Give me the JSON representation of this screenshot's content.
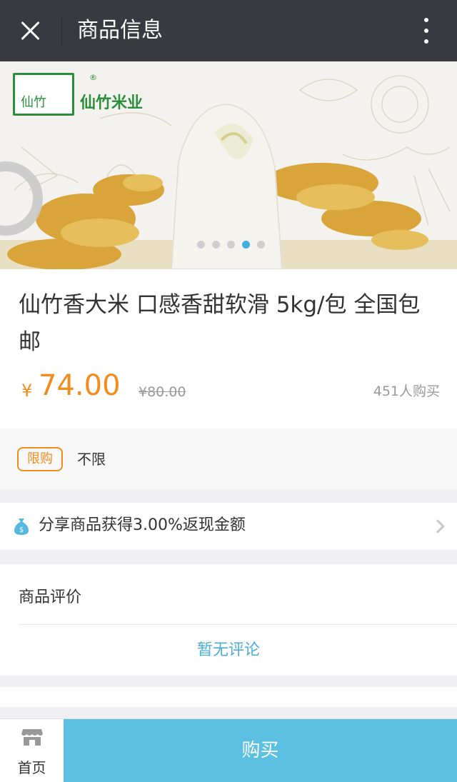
{
  "header": {
    "title": "商品信息",
    "close_icon": "close-icon",
    "more_icon": "more-vertical-icon"
  },
  "banner": {
    "brand_name": "仙竹米业",
    "brand_mark_text": "仙竹",
    "registered": "®",
    "slide_count": 5,
    "active_slide": 4
  },
  "product": {
    "name": "仙竹香大米 口感香甜软滑 5kg/包 全国包邮",
    "currency": "¥",
    "price": "74.00",
    "original_price": "¥80.00",
    "sold": "451人购买"
  },
  "limit": {
    "tag": "限购",
    "value": "不限"
  },
  "share": {
    "text": "分享商品获得3.00%返现金额",
    "icon": "money-bag-icon"
  },
  "reviews": {
    "title": "商品评价",
    "empty": "暂无评论"
  },
  "bottom_bar": {
    "home_label": "首页",
    "home_icon": "shop-icon",
    "buy_label": "购买"
  },
  "colors": {
    "accent": "#f28c1d",
    "buy": "#5bc0e1",
    "link": "#4aafd8",
    "topbar": "#393a3f"
  }
}
